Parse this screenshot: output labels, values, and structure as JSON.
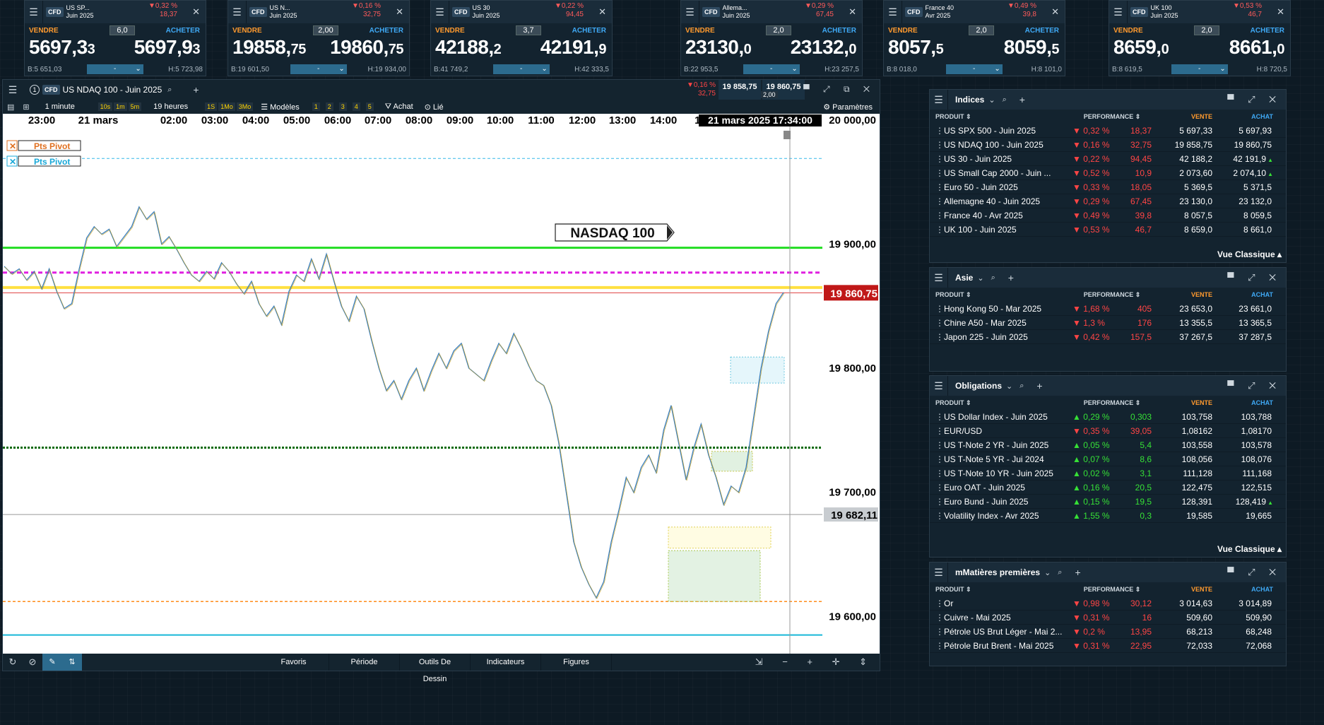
{
  "tickers": [
    {
      "name": "US SP...",
      "contract": "Juin 2025",
      "chg_pct": "0,32 %",
      "chg_abs": "18,37",
      "spread": "6,0",
      "sell_label": "VENDRE",
      "buy_label": "ACHETER",
      "sell_main": "5697,3",
      "sell_sub": "3",
      "buy_main": "5697,9",
      "buy_sub": "3",
      "low": "B:5 651,03",
      "high": "H:5 723,98",
      "select": "-"
    },
    {
      "name": "US N...",
      "contract": "Juin 2025",
      "chg_pct": "0,16 %",
      "chg_abs": "32,75",
      "spread": "2,00",
      "sell_label": "VENDRE",
      "buy_label": "ACHETER",
      "sell_main": "19858,",
      "sell_sub": "75",
      "buy_main": "19860,",
      "buy_sub": "75",
      "low": "B:19 601,50",
      "high": "H:19 934,00",
      "select": "-"
    },
    {
      "name": "US 30",
      "contract": "Juin 2025",
      "chg_pct": "0,22 %",
      "chg_abs": "94,45",
      "spread": "3,7",
      "sell_label": "VENDRE",
      "buy_label": "ACHETER",
      "sell_main": "42188,",
      "sell_sub": "2",
      "buy_main": "42191,",
      "buy_sub": "9",
      "low": "B:41 749,2",
      "high": "H:42 333,5",
      "select": "-"
    },
    {
      "name": "Allema...",
      "contract": "Juin 2025",
      "chg_pct": "0,29 %",
      "chg_abs": "67,45",
      "spread": "2,0",
      "sell_label": "VENDRE",
      "buy_label": "ACHETER",
      "sell_main": "23130,",
      "sell_sub": "0",
      "buy_main": "23132,",
      "buy_sub": "0",
      "low": "B:22 953,5",
      "high": "H:23 257,5",
      "select": "-"
    },
    {
      "name": "France 40",
      "contract": "Avr 2025",
      "chg_pct": "0,49 %",
      "chg_abs": "39,8",
      "spread": "2,0",
      "sell_label": "VENDRE",
      "buy_label": "ACHETER",
      "sell_main": "8057,",
      "sell_sub": "5",
      "buy_main": "8059,",
      "buy_sub": "5",
      "low": "B:8 018,0",
      "high": "H:8 101,0",
      "select": "-"
    },
    {
      "name": "UK 100",
      "contract": "Juin 2025",
      "chg_pct": "0,53 %",
      "chg_abs": "46,7",
      "spread": "2,0",
      "sell_label": "VENDRE",
      "buy_label": "ACHETER",
      "sell_main": "8659,",
      "sell_sub": "0",
      "buy_main": "8661,",
      "buy_sub": "0",
      "low": "B:8 619,5",
      "high": "H:8 720,5",
      "select": "-"
    }
  ],
  "chart": {
    "title": "US NDAQ 100 - Juin 2025",
    "tab_num": "1",
    "cfd": "CFD",
    "chg_pct": "0,16 %",
    "chg_abs": "32,75",
    "sell": "19 858,75",
    "buy": "19 860,75",
    "spread": "2,00",
    "timeframe": "1 minute",
    "tf_buttons": [
      "10s",
      "1m",
      "5m"
    ],
    "range": "19 heures",
    "range_buttons": [
      "1S",
      "1Mo",
      "3Mo"
    ],
    "models": "Modèles",
    "nums": [
      "1",
      "2",
      "3",
      "4",
      "5"
    ],
    "achat": "Achat",
    "lie": "Lié",
    "params": "Paramètres",
    "time_labels": [
      "23:00",
      "21 mars",
      "02:00",
      "03:00",
      "04:00",
      "05:00",
      "06:00",
      "07:00",
      "08:00",
      "09:00",
      "10:00",
      "11:00",
      "12:00",
      "13:00",
      "14:00",
      "15:"
    ],
    "time_badge": "21 mars 2025 17:34:00",
    "y_labels": [
      "20 000,00",
      "19 900,00",
      "19 800,00",
      "19 700,00",
      "19 600,00"
    ],
    "price_badge": "19 860,75",
    "level_badge": "19 682,11",
    "instrument_label": "NASDAQ 100",
    "pivot1": "Pts Pivot",
    "pivot2": "Pts Pivot",
    "bottom": [
      "Favoris",
      "Période",
      "Outils De Dessin",
      "Indicateurs",
      "Figures"
    ]
  },
  "chart_data": {
    "type": "line",
    "title": "",
    "xlabel": "",
    "ylabel": "",
    "x_ticks": [
      "23:00",
      "21 mars",
      "02:00",
      "03:00",
      "04:00",
      "05:00",
      "06:00",
      "07:00",
      "08:00",
      "09:00",
      "10:00",
      "11:00",
      "12:00",
      "13:00",
      "14:00"
    ],
    "ylim": [
      19570,
      20005
    ],
    "series": [
      {
        "values": [
          19882,
          19876,
          19880,
          19871,
          19878,
          19864,
          19880,
          19862,
          19848,
          19852,
          19880,
          19905,
          19914,
          19908,
          19912,
          19898,
          19906,
          19914,
          19930,
          19920,
          19926,
          19900,
          19906,
          19896,
          19885,
          19875,
          19870,
          19878,
          19872,
          19885,
          19878,
          19868,
          19860,
          19870,
          19852,
          19842,
          19850,
          19835,
          19862,
          19875,
          19870,
          19888,
          19872,
          19892,
          19870,
          19850,
          19838,
          19858,
          19848,
          19823,
          19800,
          19782,
          19790,
          19775,
          19790,
          19800,
          19782,
          19798,
          19812,
          19800,
          19814,
          19820,
          19800,
          19795,
          19790,
          19806,
          19820,
          19812,
          19828,
          19816,
          19802,
          19790,
          19786,
          19770,
          19740,
          19700,
          19660,
          19640,
          19626,
          19615,
          19628,
          19660,
          19685,
          19712,
          19700,
          19720,
          19730,
          19716,
          19750,
          19770,
          19740,
          19710,
          19735,
          19755,
          19730,
          19712,
          19690,
          19705,
          19700,
          19720,
          19760,
          19800,
          19830,
          19852,
          19861
        ]
      }
    ],
    "levels": {
      "green": 19897,
      "magenta": 19877,
      "yellow": 19865,
      "red": 19860.75,
      "dark_green": 19736,
      "grey": 19682.11,
      "cyan": 19585,
      "orange_dash": 19612,
      "cyan_dash": 19969
    }
  },
  "panels": [
    {
      "title": "Indices",
      "cols": [
        "PRODUIT",
        "PERFORMANCE",
        "VENTE",
        "ACHAT"
      ],
      "footer": "Vue Classique",
      "rows": [
        {
          "name": "US SPX 500 - Juin 2025",
          "dir": "dn",
          "pc": "0,32 %",
          "ab": "18,37",
          "ve": "5 697,33",
          "ac": "5 697,93",
          "tick": ""
        },
        {
          "name": "US NDAQ 100 - Juin 2025",
          "dir": "dn",
          "pc": "0,16 %",
          "ab": "32,75",
          "ve": "19 858,75",
          "ac": "19 860,75",
          "tick": ""
        },
        {
          "name": "US 30 - Juin 2025",
          "dir": "dn",
          "pc": "0,22 %",
          "ab": "94,45",
          "ve": "42 188,2",
          "ac": "42 191,9",
          "tick": "▲"
        },
        {
          "name": "US Small Cap 2000 - Juin ...",
          "dir": "dn",
          "pc": "0,52 %",
          "ab": "10,9",
          "ve": "2 073,60",
          "ac": "2 074,10",
          "tick": "▲"
        },
        {
          "name": "Euro 50 - Juin 2025",
          "dir": "dn",
          "pc": "0,33 %",
          "ab": "18,05",
          "ve": "5 369,5",
          "ac": "5 371,5",
          "tick": ""
        },
        {
          "name": "Allemagne 40 - Juin 2025",
          "dir": "dn",
          "pc": "0,29 %",
          "ab": "67,45",
          "ve": "23 130,0",
          "ac": "23 132,0",
          "tick": ""
        },
        {
          "name": "France 40 - Avr 2025",
          "dir": "dn",
          "pc": "0,49 %",
          "ab": "39,8",
          "ve": "8 057,5",
          "ac": "8 059,5",
          "tick": ""
        },
        {
          "name": "UK 100 - Juin 2025",
          "dir": "dn",
          "pc": "0,53 %",
          "ab": "46,7",
          "ve": "8 659,0",
          "ac": "8 661,0",
          "tick": ""
        }
      ]
    },
    {
      "title": "Asie",
      "cols": [
        "PRODUIT",
        "PERFORMANCE",
        "VENTE",
        "ACHAT"
      ],
      "footer": "",
      "rows": [
        {
          "name": "Hong Kong 50 - Mar 2025",
          "dir": "dn",
          "pc": "1,68 %",
          "ab": "405",
          "ve": "23 653,0",
          "ac": "23 661,0",
          "tick": ""
        },
        {
          "name": "Chine A50 - Mar 2025",
          "dir": "dn",
          "pc": "1,3 %",
          "ab": "176",
          "ve": "13 355,5",
          "ac": "13 365,5",
          "tick": ""
        },
        {
          "name": "Japon 225 - Juin 2025",
          "dir": "dn",
          "pc": "0,42 %",
          "ab": "157,5",
          "ve": "37 267,5",
          "ac": "37 287,5",
          "tick": ""
        }
      ]
    },
    {
      "title": "Obligations",
      "cols": [
        "PRODUIT",
        "PERFORMANCE",
        "VENTE",
        "ACHAT"
      ],
      "footer": "Vue Classique",
      "rows": [
        {
          "name": "US Dollar Index - Juin 2025",
          "dir": "up",
          "pc": "0,29 %",
          "ab": "0,303",
          "ve": "103,758",
          "ac": "103,788",
          "tick": ""
        },
        {
          "name": "EUR/USD",
          "dir": "dn",
          "pc": "0,35 %",
          "ab": "39,05",
          "ve": "1,08162",
          "ac": "1,08170",
          "tick": ""
        },
        {
          "name": "US T-Note 2 YR - Juin 2025",
          "dir": "up",
          "pc": "0,05 %",
          "ab": "5,4",
          "ve": "103,558",
          "ac": "103,578",
          "tick": ""
        },
        {
          "name": "US T-Note 5 YR - Jui 2024",
          "dir": "up",
          "pc": "0,07 %",
          "ab": "8,6",
          "ve": "108,056",
          "ac": "108,076",
          "tick": ""
        },
        {
          "name": "US T-Note 10 YR - Juin 2025",
          "dir": "up",
          "pc": "0,02 %",
          "ab": "3,1",
          "ve": "111,128",
          "ac": "111,168",
          "tick": ""
        },
        {
          "name": "Euro OAT - Juin 2025",
          "dir": "up",
          "pc": "0,16 %",
          "ab": "20,5",
          "ve": "122,475",
          "ac": "122,515",
          "tick": ""
        },
        {
          "name": "Euro Bund - Juin 2025",
          "dir": "up",
          "pc": "0,15 %",
          "ab": "19,5",
          "ve": "128,391",
          "ac": "128,419",
          "tick": "▲"
        },
        {
          "name": "Volatility Index - Avr 2025",
          "dir": "up",
          "pc": "1,55 %",
          "ab": "0,3",
          "ve": "19,585",
          "ac": "19,665",
          "tick": ""
        }
      ]
    },
    {
      "title": "mMatières premières",
      "cols": [
        "PRODUIT",
        "PERFORMANCE",
        "VENTE",
        "ACHAT"
      ],
      "footer": "",
      "rows": [
        {
          "name": "Or",
          "dir": "dn",
          "pc": "0,98 %",
          "ab": "30,12",
          "ve": "3 014,63",
          "ac": "3 014,89",
          "tick": ""
        },
        {
          "name": "Cuivre - Mai 2025",
          "dir": "dn",
          "pc": "0,31 %",
          "ab": "16",
          "ve": "509,60",
          "ac": "509,90",
          "tick": ""
        },
        {
          "name": "Pétrole US Brut Léger - Mai 2...",
          "dir": "dn",
          "pc": "0,2 %",
          "ab": "13,95",
          "ve": "68,213",
          "ac": "68,248",
          "tick": ""
        },
        {
          "name": "Pétrole Brut Brent - Mai 2025",
          "dir": "dn",
          "pc": "0,31 %",
          "ab": "22,95",
          "ve": "72,033",
          "ac": "72,068",
          "tick": ""
        }
      ]
    }
  ]
}
